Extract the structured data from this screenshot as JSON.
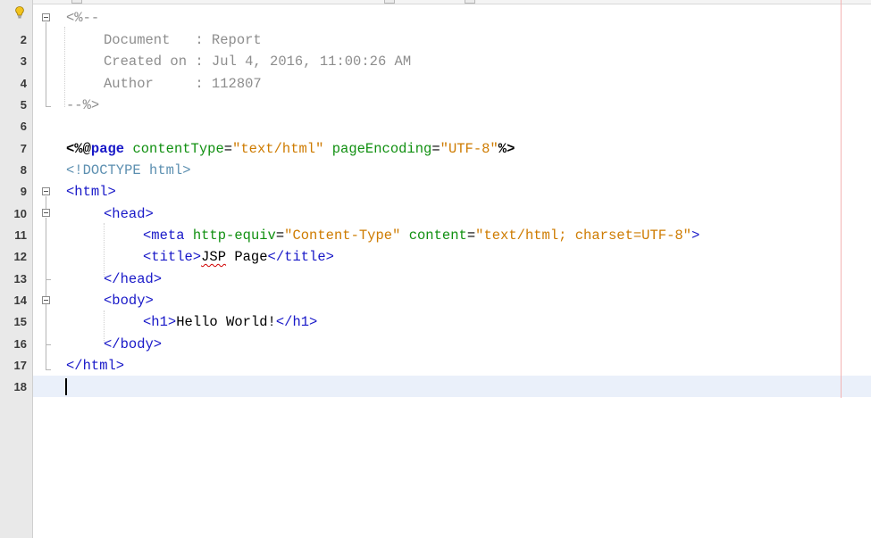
{
  "gutter": {
    "line_numbers": [
      "2",
      "3",
      "4",
      "5",
      "6",
      "7",
      "8",
      "9",
      "10",
      "11",
      "12",
      "13",
      "14",
      "15",
      "16",
      "17",
      "18"
    ]
  },
  "code": {
    "l1": {
      "open": "<%--"
    },
    "l2": {
      "text": "Document   : Report"
    },
    "l3": {
      "text": "Created on : Jul 4, 2016, 11:00:26 AM"
    },
    "l4": {
      "text": "Author     : 112807"
    },
    "l5": {
      "close": "--%>"
    },
    "l7": {
      "open": "<%@",
      "keyword": "page",
      "attr1": "contentType",
      "eq1": "=",
      "val1": "\"text/html\"",
      "attr2": "pageEncoding",
      "eq2": "=",
      "val2": "\"UTF-8\"",
      "close": "%>"
    },
    "l8": {
      "text": "<!DOCTYPE html>"
    },
    "l9": {
      "text": "<html>"
    },
    "l10": {
      "text": "<head>"
    },
    "l11": {
      "open": "<meta",
      "attr1": "http-equiv",
      "eq1": "=",
      "val1": "\"Content-Type\"",
      "attr2": "content",
      "eq2": "=",
      "val2": "\"text/html; charset=UTF-8\"",
      "close": ">"
    },
    "l12": {
      "open": "<title>",
      "underlined": "JSP",
      "rest": " Page",
      "close": "</title>"
    },
    "l13": {
      "text": "</head>"
    },
    "l14": {
      "text": "<body>"
    },
    "l15": {
      "open": "<h1>",
      "text": "Hello World!",
      "close": "</h1>"
    },
    "l16": {
      "text": "</body>"
    },
    "l17": {
      "text": "</html>"
    }
  },
  "colors": {
    "comment": "#8d8d8d",
    "tag": "#1818c8",
    "attribute": "#119011",
    "string": "#ce7b00",
    "doctype": "#5c8fb0",
    "current_line": "#eaf0fa",
    "margin_line": "#f3b3b3"
  },
  "icons": {
    "hint": "lightbulb-icon",
    "fold": "fold-collapse-icon"
  }
}
